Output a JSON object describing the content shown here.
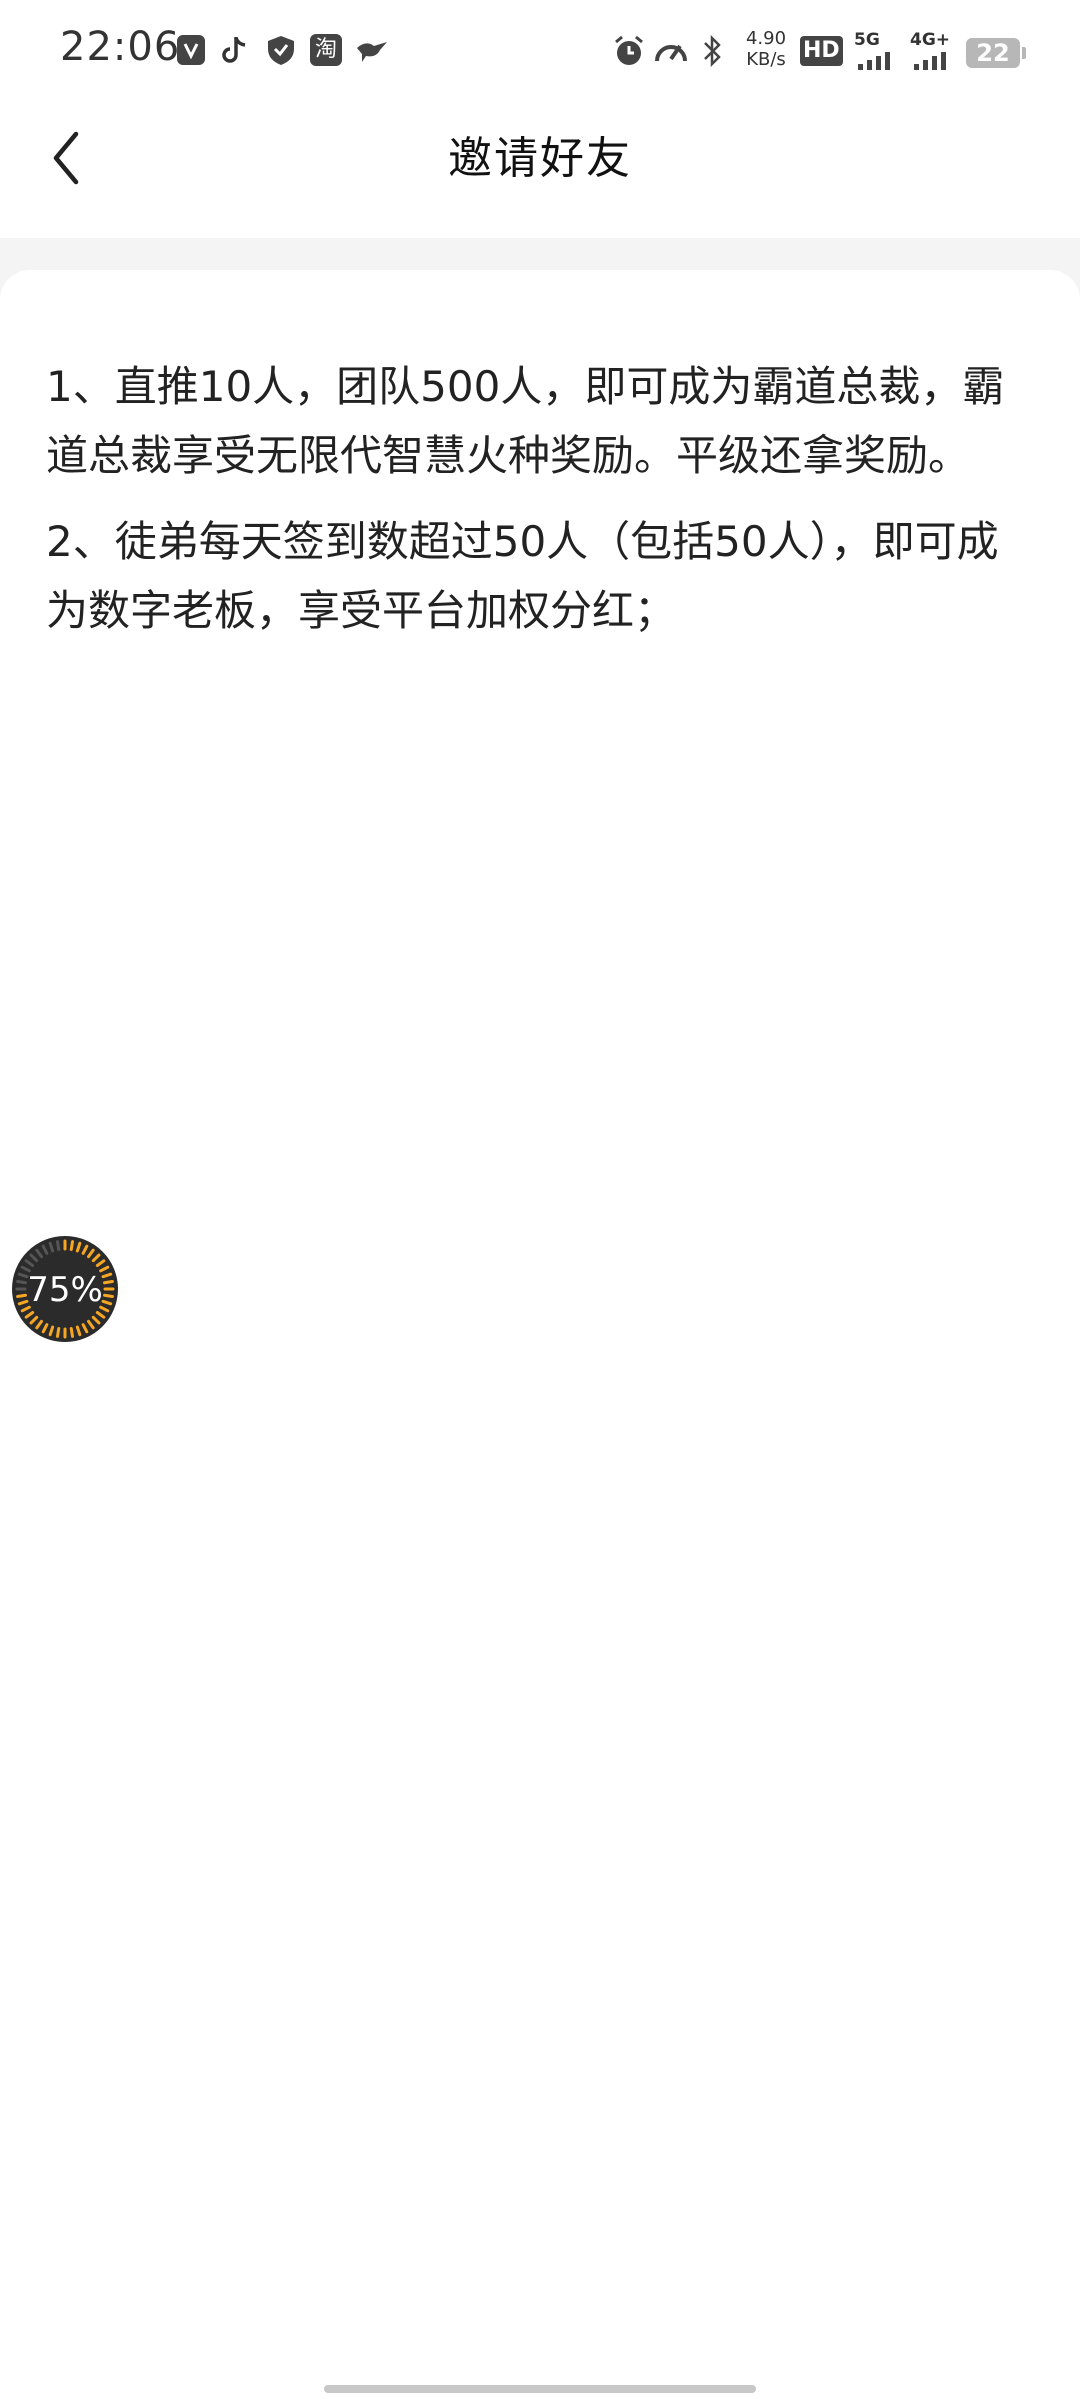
{
  "status_bar": {
    "time": "22:06",
    "net_speed_value": "4.90",
    "net_speed_unit": "KB/s",
    "hd_label": "HD",
    "sim1_label": "5G",
    "sim2_label": "4G+",
    "battery_level": "22",
    "icons": [
      "shield-app-icon",
      "tiktok-icon",
      "security-app-icon",
      "taobao-icon",
      "bird-app-icon",
      "alarm-icon",
      "speedometer-icon",
      "bluetooth-icon"
    ],
    "taobao_glyph": "淘"
  },
  "header": {
    "title": "邀请好友",
    "back_icon": "chevron-left-icon"
  },
  "rules": [
    {
      "text": "1、直推10人，团队500人，即可成为霸道总裁，霸道总裁享受无限代智慧火种奖励。平级还拿奖励。"
    },
    {
      "text": "2、徒弟每天签到数超过50人（包括50人），即可成为数字老板，享受平台加权分红；"
    }
  ],
  "progress_bubble": {
    "percent": 75,
    "label": "75%",
    "accent_color": "#f5a623"
  }
}
